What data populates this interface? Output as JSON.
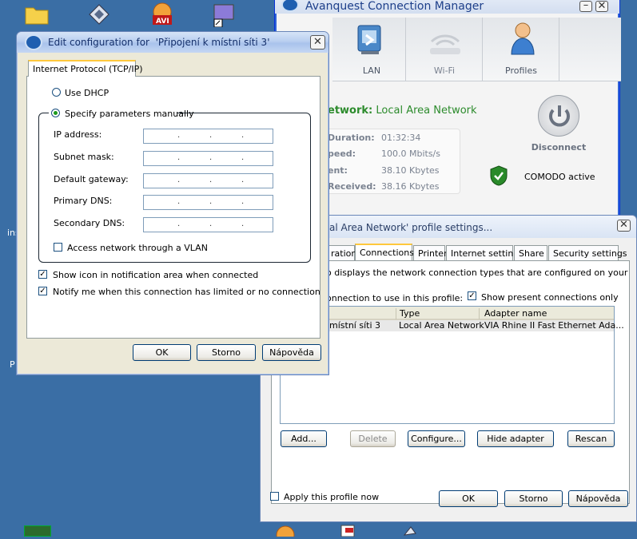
{
  "desktop": {
    "left_label_1": "ins",
    "left_label_2": "P"
  },
  "acm": {
    "title": "Avanquest Connection Manager",
    "tabs": [
      {
        "label": "LAN"
      },
      {
        "label": "Wi-Fi"
      },
      {
        "label": "Profiles"
      }
    ],
    "network_label": "etwork:",
    "network_value": "Local Area Network",
    "stats": [
      {
        "label": "Duration:",
        "value": "01:32:34"
      },
      {
        "label": "peed:",
        "value": "100.0 Mbits/s"
      },
      {
        "label": "ent:",
        "value": "38.10 Kbytes"
      },
      {
        "label": "Received:",
        "value": "38.16 Kbytes"
      }
    ],
    "disconnect_label": "Disconnect",
    "comodo_label": "COMODO active"
  },
  "profile": {
    "title": "al Area Network' profile settings...",
    "tabs": [
      "ration",
      "Connections",
      "Printer",
      "Internet settings",
      "Share",
      "Security settings"
    ],
    "description": "o displays the network connection types that are configured on your",
    "select_label": "onnection to use in this profile:",
    "show_present_label": "Show present connections only",
    "columns": [
      "",
      "Type",
      "Adapter name"
    ],
    "rows": [
      {
        "name": "místní síti 3",
        "type": "Local Area Network",
        "adapter": "VIA Rhine II Fast Ethernet Ada..."
      }
    ],
    "buttons": {
      "add": "Add...",
      "delete": "Delete",
      "configure": "Configure...",
      "hide_adapter": "Hide adapter",
      "rescan": "Rescan"
    },
    "apply_label": "Apply this profile now",
    "ok": "OK",
    "cancel": "Storno",
    "help": "Nápověda"
  },
  "editcfg": {
    "title": "Edit configuration for  'Připojení k místní síti 3'",
    "tab": "Internet Protocol (TCP/IP)",
    "use_dhcp": "Use DHCP",
    "specify_manually": "Specify parameters manually",
    "fields": [
      {
        "label": "IP address:"
      },
      {
        "label": "Subnet mask:"
      },
      {
        "label": "Default gateway:"
      },
      {
        "label": "Primary DNS:"
      },
      {
        "label": "Secondary DNS:"
      }
    ],
    "vlan": "Access network through a VLAN",
    "show_icon": "Show icon in notification area when connected",
    "notify": "Notify me when this connection has limited or no connection",
    "ok": "OK",
    "cancel": "Storno",
    "help": "Nápověda"
  }
}
